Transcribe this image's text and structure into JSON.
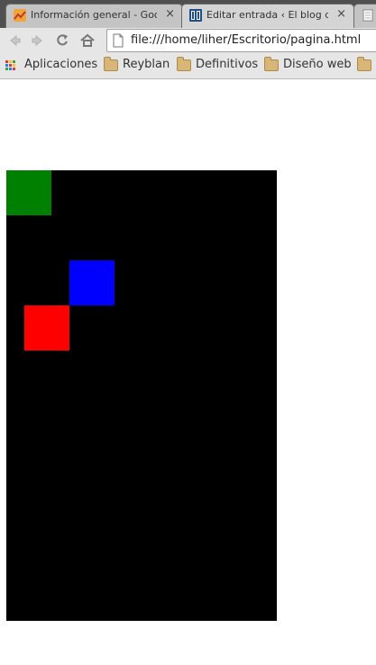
{
  "tabs": [
    {
      "title": "Información general - Goo",
      "active": false,
      "icon": "analytics-icon"
    },
    {
      "title": "Editar entrada ‹ El blog de",
      "active": true,
      "icon": "blogger-icon"
    },
    {
      "title": "",
      "active": false,
      "icon": "page-icon"
    }
  ],
  "close_glyph": "×",
  "toolbar": {
    "url": "file:///home/liher/Escritorio/pagina.html"
  },
  "bookmarks": [
    {
      "label": "Aplicaciones",
      "icon": "apps-icon"
    },
    {
      "label": "Reyblan",
      "icon": "folder-icon"
    },
    {
      "label": "Definitivos",
      "icon": "folder-icon"
    },
    {
      "label": "Diseño web",
      "icon": "folder-icon"
    },
    {
      "label": "",
      "icon": "folder-icon"
    }
  ],
  "page": {
    "canvas_color": "#000000",
    "blocks": [
      {
        "name": "green-block",
        "color": "#008000"
      },
      {
        "name": "blue-block",
        "color": "#0000ff"
      },
      {
        "name": "red-block",
        "color": "#ff0000"
      }
    ]
  }
}
